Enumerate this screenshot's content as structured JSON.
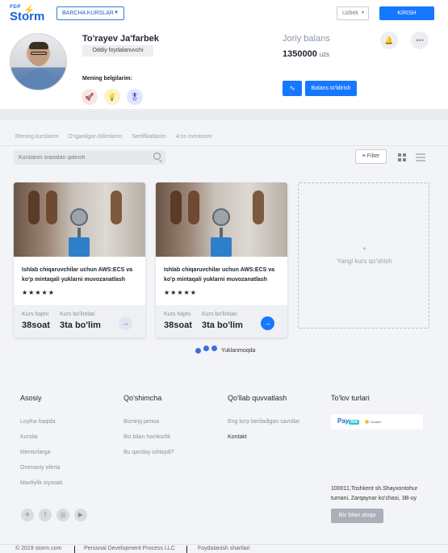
{
  "header": {
    "logo_top": "PDP",
    "logo_main": "Storm",
    "courses_dropdown": "BARCHA KURSLAR",
    "language": "Uzbek",
    "login_label": "KIRISH"
  },
  "profile": {
    "name": "To'rayev Ja'farbek",
    "role": "Oddiy foydalanuvchi",
    "badges_label": "Mening belgilarim:",
    "badges": [
      {
        "icon": "rocket-icon",
        "glyph": "🚀"
      },
      {
        "icon": "bulb-icon",
        "glyph": "💡"
      },
      {
        "icon": "medal-icon",
        "glyph": "🎖"
      }
    ],
    "balance_label": "Joriy balans",
    "balance_amount": "1350000",
    "balance_currency": "UZS",
    "topup_label": "Balans to'ldirish"
  },
  "tabs": [
    "Mening kurslarim",
    "O'rganilgan bilimlarim",
    "Sertifikatlarim",
    "A'zo mentorim"
  ],
  "search": {
    "placeholder": "Kurslarim orasidan qidirish"
  },
  "filter_label": "Filter",
  "courses": [
    {
      "title": "Ishlab chiqaruvchilar uchun AWS:ECS va ko'p mintaqali yuklarni muvozanatlash",
      "stars": "★★★★★",
      "duration_label": "Kurs hajmi",
      "duration": "38soat",
      "modules_label": "Kurs bo'limlari",
      "modules": "3ta bo'lim"
    },
    {
      "title": "Ishlab chiqaruvchilar uchun AWS:ECS va ko'p mintaqali yuklarni muvozanatlash",
      "stars": "★★★★★",
      "duration_label": "Kurs hajmi",
      "duration": "38soat",
      "modules_label": "Kurs bo'limlari",
      "modules": "3ta bo'lim"
    }
  ],
  "add_course": {
    "plus": "+",
    "label": "Yangi kurs qo'shish"
  },
  "loading_text": "Yuklanmoqda",
  "footer": {
    "col1": {
      "heading": "Asosiy",
      "links": [
        "Loyiha haqida",
        "Kurslar",
        "Mentorlarga",
        "Ommaviy oferta",
        "Maxfiylik siyosati"
      ]
    },
    "col2": {
      "heading": "Qo'shimcha",
      "links": [
        "Bizning jamoa",
        "Biz bilan hamkorlik",
        "Bu qanday ishlaydi?"
      ]
    },
    "col3": {
      "heading": "Qo'llab quvvatlash",
      "links": [
        "Eng ko'p beriladigan savollar",
        "Kontakt"
      ]
    },
    "col4": {
      "heading": "To'lov turlari",
      "payme_pay": "Pay",
      "payme_me": "me",
      "uzcard": "Uzcard"
    },
    "address": "100011,Toshkent sh.Shayxontohur tumani, Zarqaynar ko'chasi, 3B-uy",
    "contact_button": "Biz bilan aloqa",
    "social": [
      "telegram-icon",
      "facebook-icon",
      "instagram-icon",
      "youtube-icon"
    ],
    "copyright": "© 2019 storm.com",
    "company": "Personal Development Process LLC",
    "terms": "Foydalanish shartlari"
  },
  "colors": {
    "accent": "#1677ff",
    "background": "#f3f4f7"
  }
}
